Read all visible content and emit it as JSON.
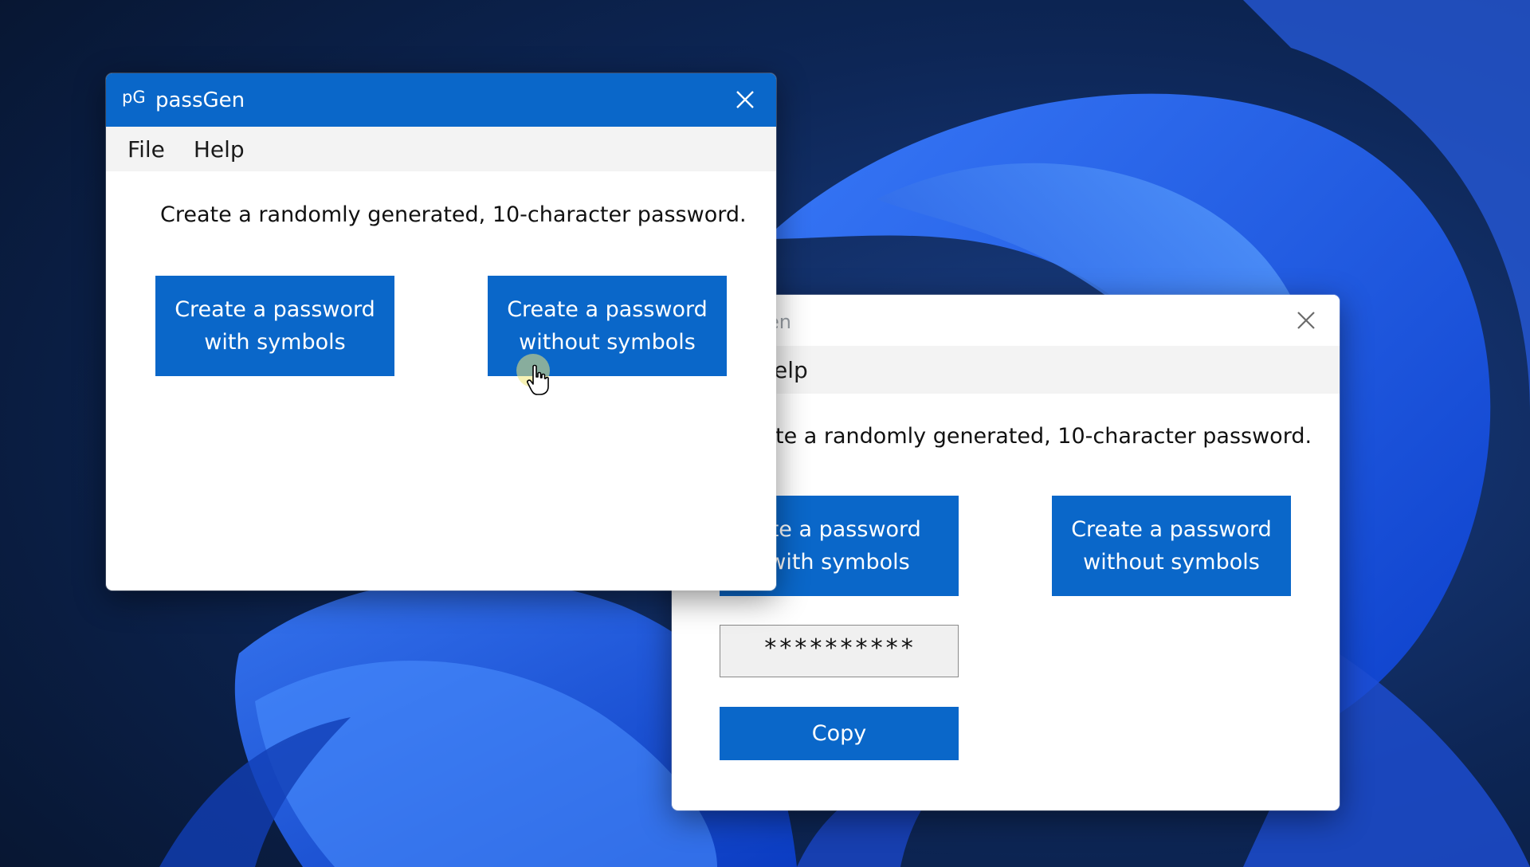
{
  "back_window": {
    "title": "en",
    "menu": [
      "elp"
    ],
    "description": "te a randomly generated, 10-character password.",
    "button_with_symbols": [
      "ate a password",
      "with symbols"
    ],
    "button_without_symbols": [
      "Create a password",
      "without symbols"
    ],
    "password_value": "**********",
    "copy_label": "Copy"
  },
  "front_window": {
    "app_logo": "pG",
    "title": "passGen",
    "menu": [
      "File",
      "Help"
    ],
    "description": "Create a randomly generated, 10-character password.",
    "button_with_symbols": [
      "Create a password",
      "with symbols"
    ],
    "button_without_symbols": [
      "Create a password",
      "without symbols"
    ]
  },
  "colors": {
    "accent": "#0a67c9",
    "menubar": "#f3f3f3",
    "window_bg": "#ffffff"
  },
  "icons": {
    "close": "close-icon",
    "cursor": "hand-pointer-icon"
  }
}
